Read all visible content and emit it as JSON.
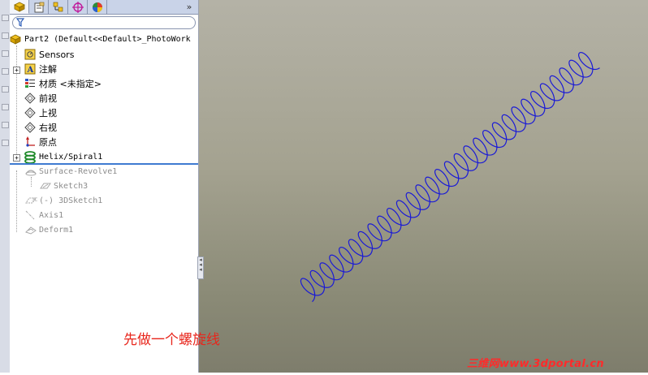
{
  "toolbar": {
    "tabs": [
      {
        "icon": "feature-manager-icon"
      },
      {
        "icon": "property-manager-icon"
      },
      {
        "icon": "configuration-manager-icon"
      },
      {
        "icon": "dimxpert-icon"
      },
      {
        "icon": "display-manager-icon"
      }
    ],
    "more": "»"
  },
  "filter": {
    "icon": "filter-icon",
    "value": ""
  },
  "tree": {
    "root": "Part2  (Default<<Default>_PhotoWork",
    "items": [
      {
        "label": "Sensors",
        "icon": "sensor-icon"
      },
      {
        "label": "注解",
        "icon": "annotations-icon"
      },
      {
        "label": "材质 <未指定>",
        "icon": "material-icon"
      },
      {
        "label": "前视",
        "icon": "plane-icon"
      },
      {
        "label": "上视",
        "icon": "plane-icon"
      },
      {
        "label": "右视",
        "icon": "plane-icon"
      },
      {
        "label": "原点",
        "icon": "origin-icon"
      },
      {
        "label": "Helix/Spiral1",
        "icon": "helix-icon"
      }
    ],
    "suppressed": [
      {
        "label": "Surface-Revolve1",
        "icon": "surface-revolve-icon"
      },
      {
        "label": "Sketch3",
        "icon": "sketch-icon"
      },
      {
        "label": "(-) 3DSketch1",
        "icon": "3d-sketch-icon"
      },
      {
        "label": "Axis1",
        "icon": "axis-icon"
      },
      {
        "label": "Deform1",
        "icon": "deform-icon"
      }
    ]
  },
  "viewport": {
    "caption": "先做一个螺旋线",
    "watermark": "三维网www.3dportal.cn",
    "helix_color": "#1a1ad6",
    "helix_turns": 30
  },
  "colors": {
    "caption": "#e8261c",
    "watermark": "#ff2a2a",
    "rollback_bar": "#3f7bd1"
  }
}
